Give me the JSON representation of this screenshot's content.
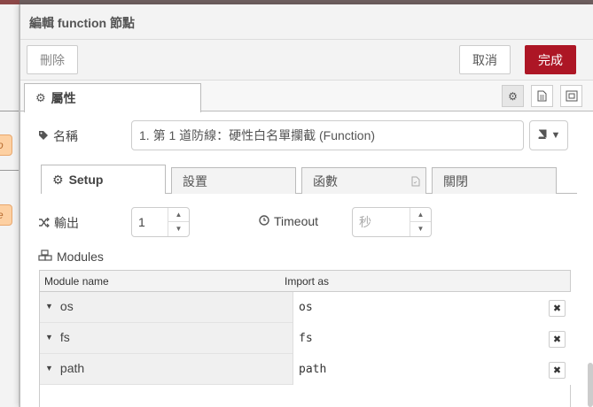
{
  "tray": {
    "title": "編輯 function 節點",
    "delete_label": "刪除",
    "cancel_label": "取消",
    "done_label": "完成",
    "properties_tab": "屬性"
  },
  "workspace": {
    "node1_text": "o",
    "node2_text": "e"
  },
  "form": {
    "name_label": "名稱",
    "name_value": "1. 第 1 道防線：硬性白名單攔截 (Function)",
    "tabs": [
      {
        "label": "Setup"
      },
      {
        "label": "設置"
      },
      {
        "label": "函數"
      },
      {
        "label": "關閉"
      }
    ],
    "outputs_label": "輸出",
    "outputs_value": "1",
    "timeout_label": "Timeout",
    "timeout_placeholder": "秒",
    "modules_label": "Modules",
    "modules_table": {
      "col_module": "Module name",
      "col_import": "Import as",
      "rows": [
        {
          "name": "os",
          "import": "os"
        },
        {
          "name": "fs",
          "import": "fs"
        },
        {
          "name": "path",
          "import": "path"
        }
      ]
    }
  },
  "colors": {
    "done_button": "#ad1625",
    "node_fill": "#fdd0a2"
  },
  "icons": [
    "gear-icon",
    "document-icon",
    "expand-icon",
    "tag-icon",
    "book-icon",
    "shuffle-icon",
    "clock-icon",
    "cubes-icon",
    "caret-down-icon",
    "close-icon"
  ]
}
